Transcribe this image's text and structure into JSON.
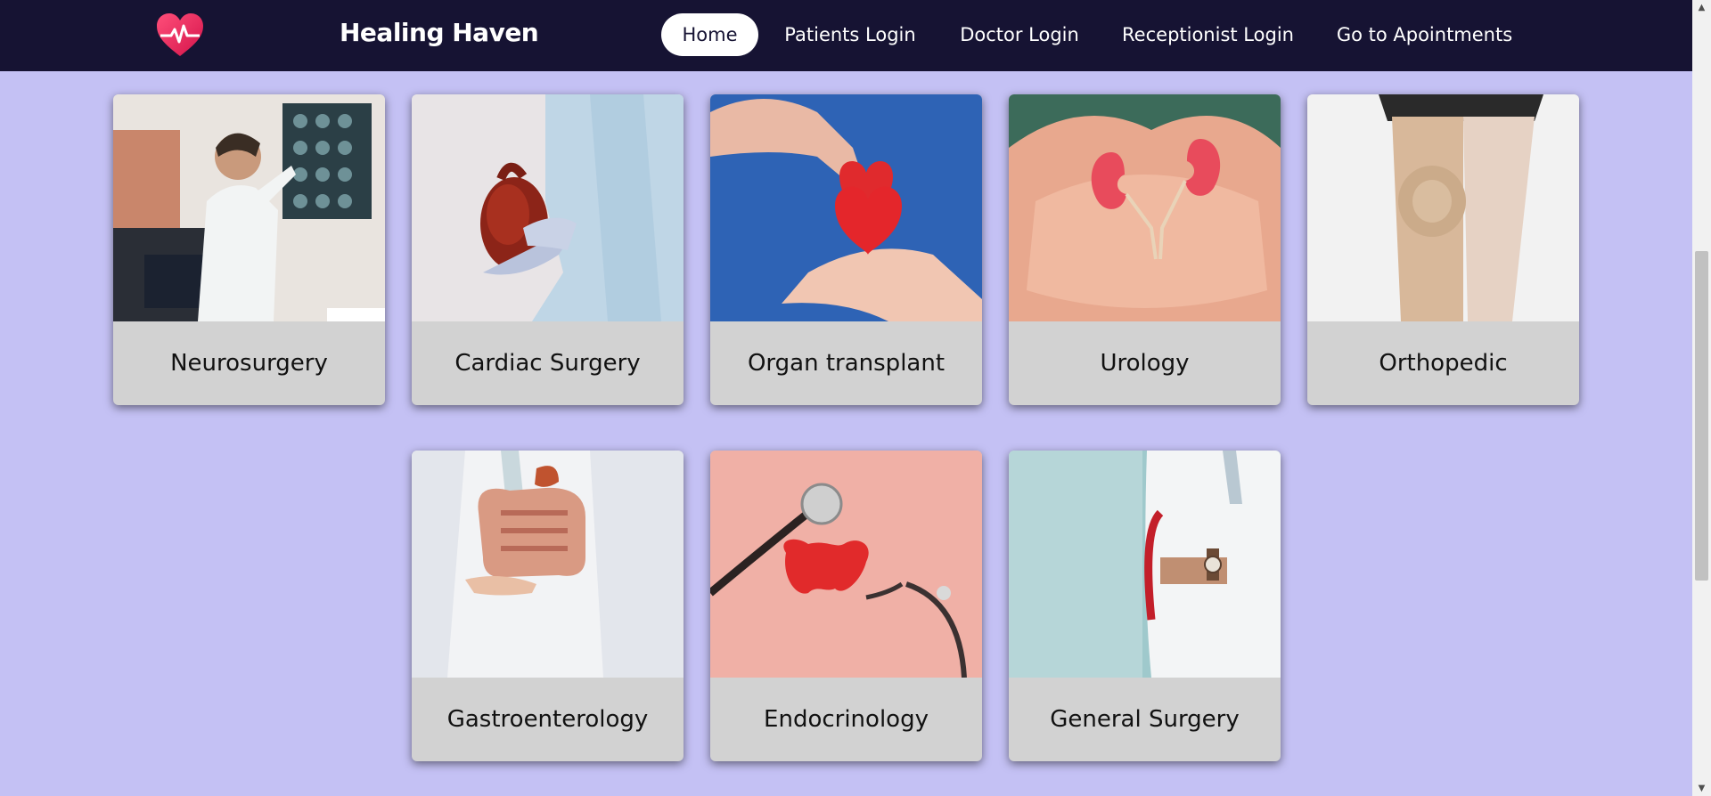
{
  "header": {
    "brand": "Healing Haven",
    "nav": [
      {
        "label": "Home",
        "active": true
      },
      {
        "label": "Patients Login",
        "active": false
      },
      {
        "label": "Doctor Login",
        "active": false
      },
      {
        "label": "Receptionist Login",
        "active": false
      },
      {
        "label": "Go to Apointments",
        "active": false
      }
    ]
  },
  "departments": [
    {
      "name": "Neurosurgery"
    },
    {
      "name": "Cardiac Surgery"
    },
    {
      "name": "Organ transplant"
    },
    {
      "name": "Urology"
    },
    {
      "name": "Orthopedic"
    },
    {
      "name": "Gastroenterology"
    },
    {
      "name": "Endocrinology"
    },
    {
      "name": "General Surgery"
    }
  ],
  "colors": {
    "navbar": "#161333",
    "page_background": "#c4c1f4",
    "card_footer": "#d2d2d2",
    "logo": "#e8275a"
  }
}
